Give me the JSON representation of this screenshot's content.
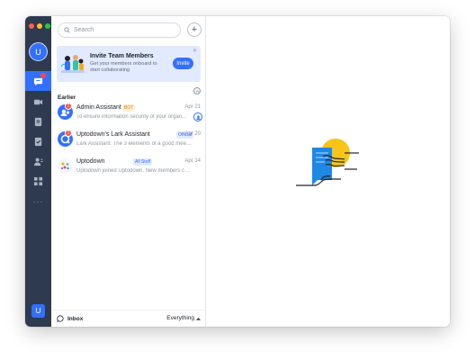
{
  "rail": {
    "user_initial": "U",
    "items": [
      {
        "name": "messenger",
        "icon": "chat-bubble-icon",
        "active": true,
        "badge": true
      },
      {
        "name": "video",
        "icon": "video-camera-icon",
        "active": false
      },
      {
        "name": "docs",
        "icon": "document-icon",
        "active": false
      },
      {
        "name": "approval",
        "icon": "approval-icon",
        "active": false
      },
      {
        "name": "contacts",
        "icon": "contacts-icon",
        "active": false
      },
      {
        "name": "workplace",
        "icon": "workplace-grid-icon",
        "active": false
      }
    ],
    "more_label": "···"
  },
  "search": {
    "placeholder": "Search"
  },
  "invite_card": {
    "title": "Invite Team Members",
    "subtitle": "Get your members onboard to start collaborating",
    "button_label": "Invite",
    "close_label": "✕"
  },
  "section": {
    "title": "Earlier"
  },
  "chats": [
    {
      "name": "Admin Assistant",
      "tag": "BOT",
      "tag_type": "bot",
      "date": "Apr 21",
      "preview": "To ensure information security of your organ...",
      "badge": "1",
      "avatar_color": "#3370ff",
      "avatar_icon": "admin-icon"
    },
    {
      "name": "Uptodown's Lark Assistant",
      "tag": "Official",
      "tag_type": "official",
      "date": "Apr 20",
      "preview": "Lark Assistant: The 3 elements of a good meet...",
      "badge": "1",
      "avatar_color": "#3370ff",
      "avatar_icon": "assistant-icon"
    },
    {
      "name": "Uptodown",
      "tag": "All Staff",
      "tag_type": "official",
      "date": "Apr 14",
      "preview": "Uptodown joined Uptodown. New members ca...",
      "badge": "",
      "avatar_color": "#f5f6f7",
      "avatar_icon": "org-icon"
    }
  ],
  "footer": {
    "inbox_label": "Inbox",
    "filter_label": "Everything"
  },
  "colors": {
    "rail": "#2d3a4f",
    "accent": "#3370ff",
    "badge": "#f54a45"
  }
}
